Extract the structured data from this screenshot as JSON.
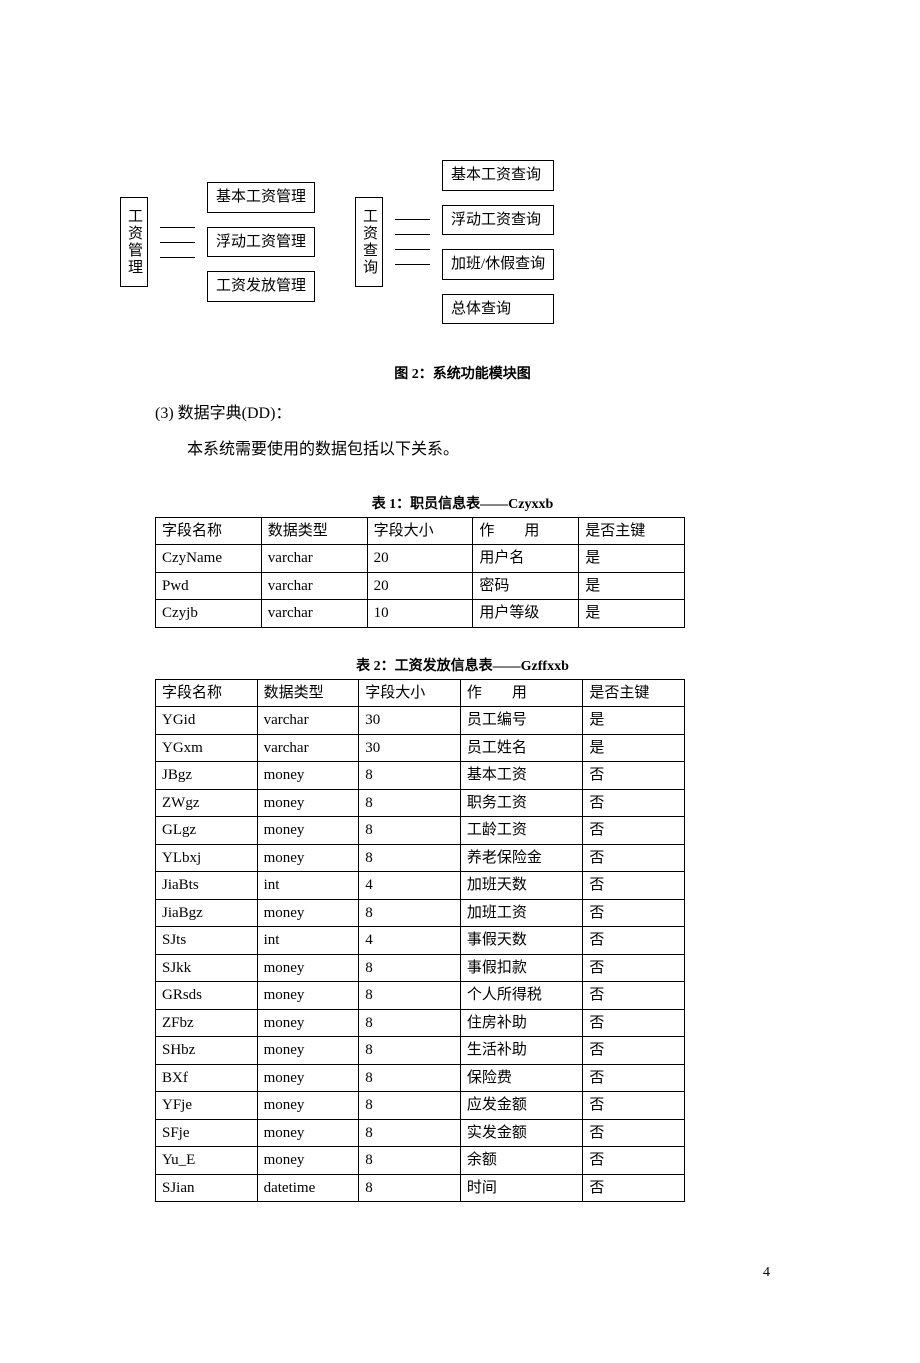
{
  "diagram": {
    "left": {
      "root": "工资管理",
      "children": [
        "基本工资管理",
        "浮动工资管理",
        "工资发放管理"
      ]
    },
    "right": {
      "root": "工资查询",
      "children": [
        "基本工资查询",
        "浮动工资查询",
        "加班/休假查询",
        "总体查询"
      ]
    },
    "caption": "图 2：系统功能模块图"
  },
  "section": {
    "heading": "(3) 数据字典(DD)：",
    "text": "本系统需要使用的数据包括以下关系。"
  },
  "table1": {
    "caption": "表 1：职员信息表——Czyxxb",
    "headers": [
      "字段名称",
      "数据类型",
      "字段大小",
      "作　　用",
      "是否主键"
    ],
    "rows": [
      [
        "CzyName",
        "varchar",
        "20",
        "用户名",
        "是"
      ],
      [
        "Pwd",
        "varchar",
        "20",
        "密码",
        "是"
      ],
      [
        "Czyjb",
        "varchar",
        "10",
        "用户等级",
        "是"
      ]
    ]
  },
  "table2": {
    "caption": "表 2：工资发放信息表——Gzffxxb",
    "headers": [
      "字段名称",
      "数据类型",
      "字段大小",
      "作　　用",
      "是否主键"
    ],
    "rows": [
      [
        "YGid",
        "varchar",
        "30",
        "员工编号",
        "是"
      ],
      [
        "YGxm",
        "varchar",
        "30",
        "员工姓名",
        "是"
      ],
      [
        "JBgz",
        "money",
        "8",
        "基本工资",
        "否"
      ],
      [
        "ZWgz",
        "money",
        "8",
        "职务工资",
        "否"
      ],
      [
        "GLgz",
        "money",
        "8",
        "工龄工资",
        "否"
      ],
      [
        "YLbxj",
        "money",
        "8",
        "养老保险金",
        "否"
      ],
      [
        "JiaBts",
        "int",
        "4",
        "加班天数",
        "否"
      ],
      [
        "JiaBgz",
        "money",
        "8",
        "加班工资",
        "否"
      ],
      [
        "SJts",
        "int",
        "4",
        "事假天数",
        "否"
      ],
      [
        "SJkk",
        "money",
        "8",
        "事假扣款",
        "否"
      ],
      [
        "GRsds",
        "money",
        "8",
        "个人所得税",
        "否"
      ],
      [
        "ZFbz",
        "money",
        "8",
        "住房补助",
        "否"
      ],
      [
        "SHbz",
        "money",
        "8",
        "生活补助",
        "否"
      ],
      [
        "BXf",
        "money",
        "8",
        "保险费",
        "否"
      ],
      [
        "YFje",
        "money",
        "8",
        "应发金额",
        "否"
      ],
      [
        "SFje",
        "money",
        "8",
        "实发金额",
        "否"
      ],
      [
        "Yu_E",
        "money",
        "8",
        "余额",
        "否"
      ],
      [
        "SJian",
        "datetime",
        "8",
        "时间",
        "否"
      ]
    ]
  },
  "pagenum": "4"
}
